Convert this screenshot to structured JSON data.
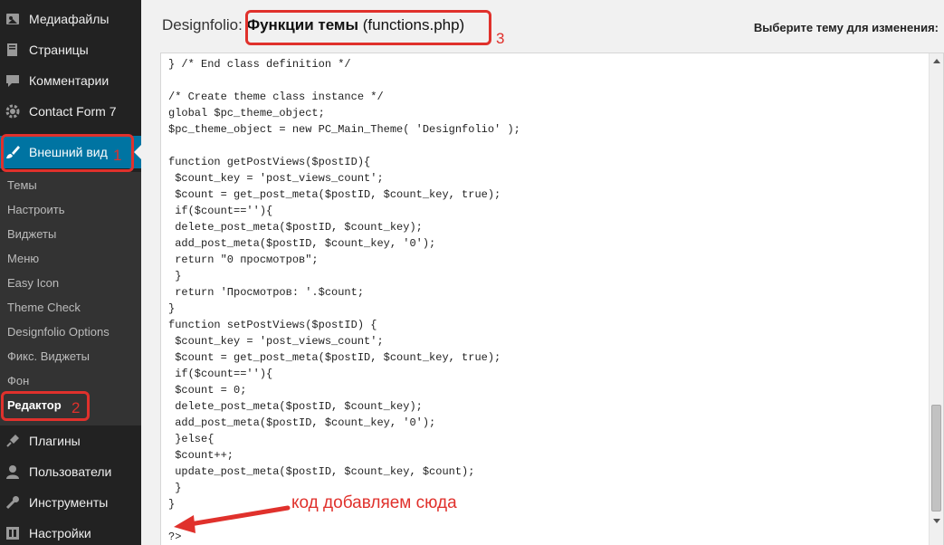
{
  "sidebar": {
    "top_items": [
      {
        "label": "Медиафайлы",
        "icon": "media-icon"
      },
      {
        "label": "Страницы",
        "icon": "pages-icon"
      },
      {
        "label": "Комментарии",
        "icon": "comments-icon"
      },
      {
        "label": "Contact Form 7",
        "icon": "gear-icon"
      }
    ],
    "appearance": {
      "label": "Внешний вид",
      "icon": "brush-icon"
    },
    "appearance_submenu": [
      "Темы",
      "Настроить",
      "Виджеты",
      "Меню",
      "Easy Icon",
      "Theme Check",
      "Designfolio Options",
      "Фикс. Виджеты",
      "Фон",
      "Редактор"
    ],
    "bottom_items": [
      {
        "label": "Плагины",
        "icon": "plugins-icon"
      },
      {
        "label": "Пользователи",
        "icon": "users-icon"
      },
      {
        "label": "Инструменты",
        "icon": "wrench-icon"
      },
      {
        "label": "Настройки",
        "icon": "settings-icon"
      }
    ]
  },
  "header": {
    "theme_name": "Designfolio:",
    "file_title": "Функции темы",
    "file_name": "(functions.php)",
    "select_theme_label": "Выберите тему для изменения:"
  },
  "annotations": {
    "num_1": "1",
    "num_2": "2",
    "num_3": "3",
    "note": "код добавляем сюда",
    "accent_color": "#e0312c"
  },
  "editor": {
    "lines": [
      "} /* End class definition */",
      "",
      "/* Create theme class instance */",
      "global $pc_theme_object;",
      "$pc_theme_object = new PC_Main_Theme( 'Designfolio' );",
      "",
      "function getPostViews($postID){",
      " $count_key = 'post_views_count';",
      " $count = get_post_meta($postID, $count_key, true);",
      " if($count==''){",
      " delete_post_meta($postID, $count_key);",
      " add_post_meta($postID, $count_key, '0');",
      " return \"0 просмотров\";",
      " }",
      " return 'Просмотров: '.$count;",
      "}",
      "function setPostViews($postID) {",
      " $count_key = 'post_views_count';",
      " $count = get_post_meta($postID, $count_key, true);",
      " if($count==''){",
      " $count = 0;",
      " delete_post_meta($postID, $count_key);",
      " add_post_meta($postID, $count_key, '0');",
      " }else{",
      " $count++;",
      " update_post_meta($postID, $count_key, $count);",
      " }",
      "}",
      "",
      "?>"
    ]
  },
  "colors": {
    "sidebar_bg": "#222222",
    "submenu_bg": "#333333",
    "active_menu": "#0074a2"
  }
}
